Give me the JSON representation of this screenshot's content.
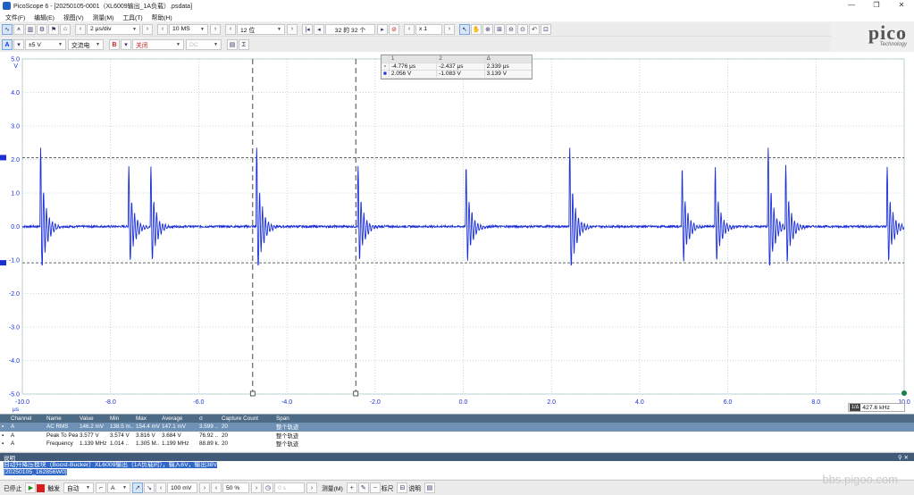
{
  "window": {
    "title": "PicoScope 6 - [20250105-0001（XL6009输出_1A负载）.psdata]",
    "controls": [
      "—",
      "❐",
      "✕"
    ]
  },
  "menu": [
    "文件(F)",
    "编辑(E)",
    "视图(V)",
    "测量(M)",
    "工具(T)",
    "帮助(H)"
  ],
  "toolbar1": {
    "timebase": "2 μs/div",
    "samples": "10 MS",
    "resolution": "12 位",
    "captures": "32 的 32 个",
    "zoom": "x 1"
  },
  "toolbar2": {
    "channelA_label": "A",
    "range": "±5 V",
    "coupling": "交流电",
    "channelB_label": "B",
    "channelB_state": "关闭",
    "channelB_coupling": "DC"
  },
  "logo": {
    "brand": "pico",
    "sub": "Technology"
  },
  "scope": {
    "y_unit": "V",
    "x_unit": "μs",
    "y_ticks": [
      "5.0",
      "4.0",
      "3.0",
      "2.0",
      "1.0",
      "0.0",
      "-1.0",
      "-2.0",
      "-3.0",
      "-4.0",
      "-5.0"
    ],
    "x_ticks": [
      "-10.0",
      "-8.0",
      "-6.0",
      "-4.0",
      "-2.0",
      "0.0",
      "2.0",
      "4.0",
      "6.0",
      "8.0",
      "10.0"
    ],
    "trace_color": "#1a2fd6",
    "h_cursor_values": [
      2.056,
      -1.083
    ],
    "v_cursor_values": [
      -4.776,
      -2.437
    ],
    "spike_times": [
      -9.6,
      -7.6,
      -7.1,
      -4.7,
      -2.4,
      0.05,
      2.4,
      4.95,
      5.7,
      6.9,
      7.3,
      9.6
    ]
  },
  "cursor_table": {
    "header": [
      "1",
      "2",
      "Δ"
    ],
    "time": [
      "-4.776 μs",
      "-2.437 μs",
      "2.339 μs"
    ],
    "volt": [
      "2.056 V",
      "-1.083 V",
      "3.139 V"
    ]
  },
  "freq_readout": {
    "ratio": "1/Δ",
    "value": "427.6 kHz"
  },
  "measurements": {
    "headers": [
      "Channel",
      "Name",
      "Value",
      "Min",
      "Max",
      "Average",
      "σ",
      "Capture Count",
      "Span"
    ],
    "rows": [
      [
        "A",
        "AC RMS",
        "146.2 mV",
        "138.5 m..",
        "154.4 mV",
        "147.1 mV",
        "3.599 ..",
        "20",
        "整个轨迹"
      ],
      [
        "A",
        "Peak To Peak",
        "3.577 V",
        "3.574 V",
        "3.816 V",
        "3.684 V",
        "76.92 ..",
        "20",
        "整个轨迹"
      ],
      [
        "A",
        "Frequency",
        "1.139 MHz",
        "1.014 ..",
        "1.305 M..",
        "1.199 MHz",
        "88.89 k..",
        "20",
        "整个轨迹"
      ]
    ]
  },
  "notes": {
    "title": "说明",
    "lines": [
      "自动升降压模块（Boost-Bucker）XL6009输出（1A负载时），输入6V，输出38V",
      "[20250105_162856W0]"
    ]
  },
  "bottombar": {
    "stop": "已停止",
    "trigger": "触发",
    "mode": "自动",
    "source": "A",
    "level": "100 mV",
    "pretrigger": "50 %",
    "delay": "0 s",
    "measure": "测量(M)",
    "ruler": "标尺",
    "notes": "说明"
  },
  "watermark": "bbs.pigoo.com"
}
